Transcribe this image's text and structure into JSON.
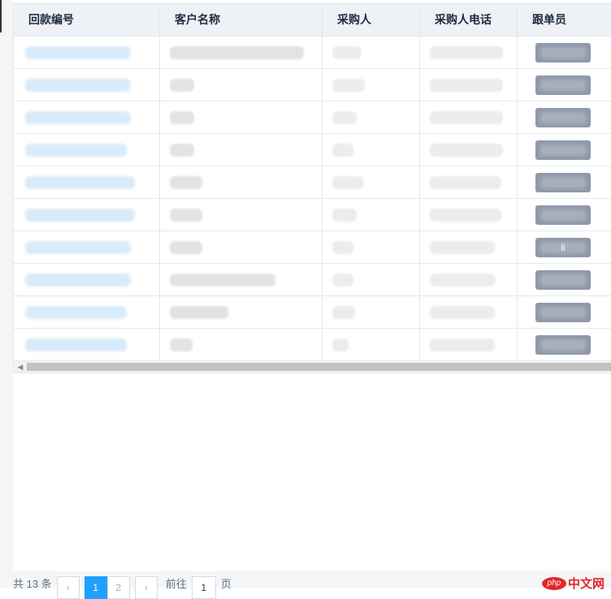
{
  "table": {
    "headers": [
      "回款编号",
      "客户名称",
      "采购人",
      "采购人电话",
      "跟单员"
    ],
    "rows": [
      {
        "c1w": 130,
        "c2w": 165,
        "c3w": 36,
        "c4w": 90,
        "tag": ""
      },
      {
        "c1w": 130,
        "c2w": 30,
        "c3w": 40,
        "c4w": 90,
        "tag": ""
      },
      {
        "c1w": 130,
        "c2w": 30,
        "c3w": 30,
        "c4w": 90,
        "tag": ""
      },
      {
        "c1w": 125,
        "c2w": 30,
        "c3w": 26,
        "c4w": 90,
        "tag": ""
      },
      {
        "c1w": 135,
        "c2w": 40,
        "c3w": 38,
        "c4w": 88,
        "tag": ""
      },
      {
        "c1w": 135,
        "c2w": 40,
        "c3w": 30,
        "c4w": 88,
        "tag": ""
      },
      {
        "c1w": 130,
        "c2w": 40,
        "c3w": 26,
        "c4w": 80,
        "tag": "li"
      },
      {
        "c1w": 130,
        "c2w": 130,
        "c3w": 26,
        "c4w": 80,
        "tag": ""
      },
      {
        "c1w": 125,
        "c2w": 72,
        "c3w": 28,
        "c4w": 80,
        "tag": ""
      },
      {
        "c1w": 125,
        "c2w": 28,
        "c3w": 20,
        "c4w": 80,
        "tag": ""
      }
    ]
  },
  "pagination": {
    "total": "共 13 条",
    "prev_icon": "chevron-left-icon",
    "pages": [
      "1",
      "2"
    ],
    "active_page": "1",
    "next_icon": "chevron-right-icon",
    "goto_prefix": "前往",
    "goto_value": "1",
    "goto_suffix": "页"
  },
  "watermark": {
    "logo": "php",
    "text": "中文网"
  },
  "colors": {
    "header_bg": "#eef1f6",
    "tag_bg": "#8f99aa",
    "active_page": "#20a0ff",
    "watermark": "#e3262c"
  }
}
